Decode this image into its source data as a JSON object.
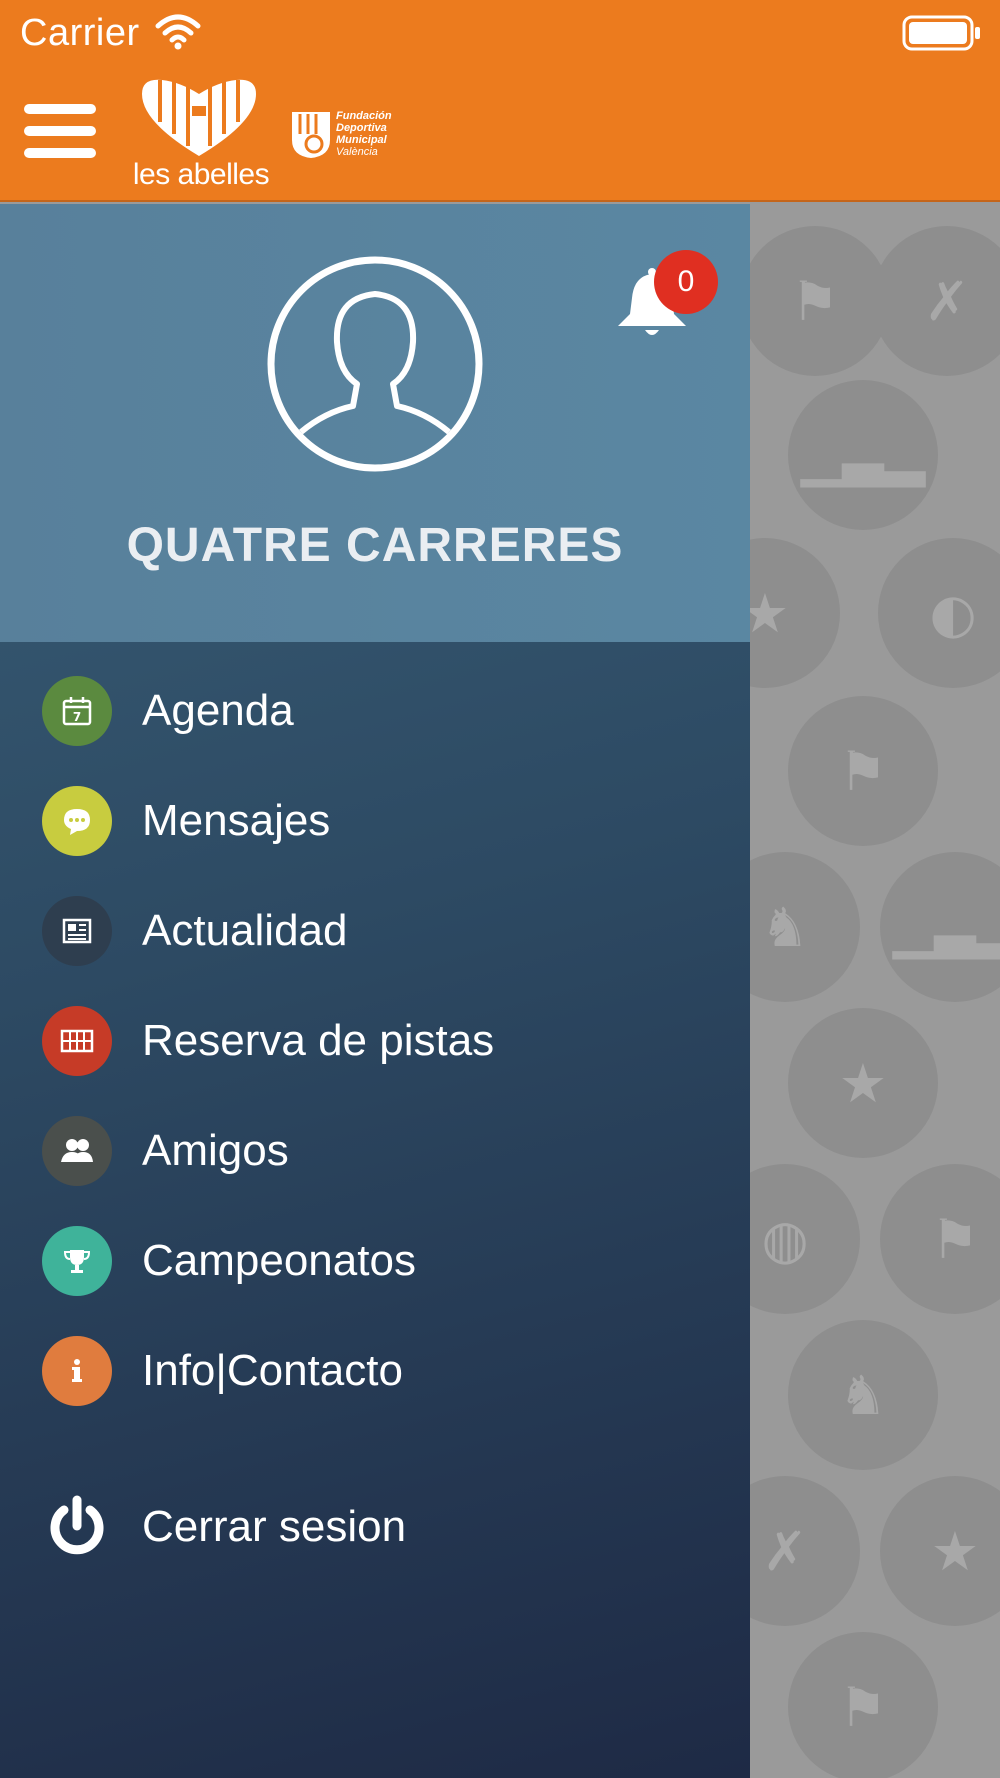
{
  "status_bar": {
    "carrier": "Carrier"
  },
  "header": {
    "brand_name": "les abelles",
    "partner_lines": [
      "Fundación",
      "Deportiva",
      "Municipal",
      "València"
    ]
  },
  "profile": {
    "name": "QUATRE CARRERES",
    "notifications_count": "0"
  },
  "menu": {
    "items": [
      {
        "label": "Agenda",
        "icon": "calendar-icon",
        "color": "#5b8a3f"
      },
      {
        "label": "Mensajes",
        "icon": "chat-bubble-icon",
        "color": "#c8cc3f"
      },
      {
        "label": "Actualidad",
        "icon": "newspaper-icon",
        "color": "#2e3e4f"
      },
      {
        "label": "Reserva de pistas",
        "icon": "court-grid-icon",
        "color": "#c63b27"
      },
      {
        "label": "Amigos",
        "icon": "friends-icon",
        "color": "#4a4f4c"
      },
      {
        "label": "Campeonatos",
        "icon": "trophy-icon",
        "color": "#3fb39a"
      },
      {
        "label": "Info|Contacto",
        "icon": "info-icon",
        "color": "#e07c3e"
      }
    ],
    "logout_label": "Cerrar sesion"
  },
  "colors": {
    "header": "#ec7b1e",
    "badge": "#e02f21"
  }
}
